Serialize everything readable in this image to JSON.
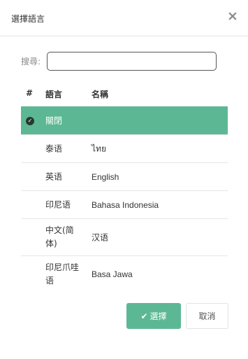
{
  "dialog": {
    "title": "選擇語言",
    "close_symbol": "×"
  },
  "search": {
    "label": "搜尋:",
    "value": "",
    "placeholder": ""
  },
  "table": {
    "headers": {
      "num": "#",
      "language": "語言",
      "name": "名稱"
    },
    "rows": [
      {
        "language": "關閉",
        "name": "",
        "selected": true,
        "check_symbol": "✓"
      },
      {
        "language": "泰语",
        "name": "ไทย",
        "selected": false
      },
      {
        "language": "英语",
        "name": "English",
        "selected": false
      },
      {
        "language": "印尼语",
        "name": "Bahasa Indonesia",
        "selected": false
      },
      {
        "language": "中文(简体)",
        "name": "汉语",
        "selected": false
      },
      {
        "language": "印尼爪哇语",
        "name": "Basa Jawa",
        "selected": false
      }
    ]
  },
  "buttons": {
    "ok_label": "選擇",
    "ok_icon": "check-icon",
    "ok_symbol": "✔",
    "cancel_label": "取消"
  },
  "colors": {
    "accent": "#5cb894",
    "check_badge": "#243a30"
  }
}
